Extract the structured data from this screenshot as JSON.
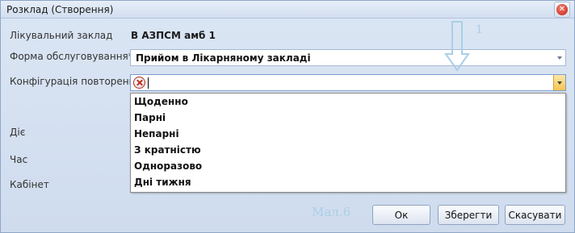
{
  "window": {
    "title": "Розклад (Створення)"
  },
  "form": {
    "facility_label": "Лікувальний заклад",
    "facility_value": "В АЗПСМ амб 1",
    "service_form_label": "Форма обслуговування*",
    "service_form_value": "Прийом в Лікарняному закладі",
    "repeat_config_label": "Конфігурація повторень*",
    "repeat_config_value": "",
    "active_label": "Діє",
    "time_label": "Час",
    "room_label": "Кабінет"
  },
  "dropdown": {
    "options": [
      "Щоденно",
      "Парні",
      "Непарні",
      "З кратністю",
      "Одноразово",
      "Дні тижня"
    ]
  },
  "buttons": {
    "ok": "Ок",
    "save": "Зберегти",
    "cancel": "Скасувати"
  },
  "annotations": {
    "number": "1",
    "figure": "Мал.6"
  },
  "colors": {
    "accent_dropdown_button": "#f6c54f",
    "error_icon": "#c62a1a",
    "annotation": "#a9cfe6"
  }
}
